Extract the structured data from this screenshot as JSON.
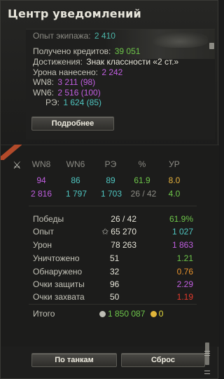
{
  "window": {
    "title": "Центр уведомлений"
  },
  "notification": {
    "crew_xp": {
      "label": "Опыт экипажа:",
      "value": "2 410"
    },
    "credits": {
      "label": "Получено кредитов:",
      "value": "39 051"
    },
    "achievements": {
      "label": "Достижения:",
      "value": "Знак классности «2 ст.»"
    },
    "damage": {
      "label": "Урона нанесено:",
      "value": "2 242"
    },
    "wn8": {
      "label": "WN8:",
      "value": "3 211 (98)"
    },
    "wn6": {
      "label": "WN6:",
      "value": "2 516 (100)"
    },
    "eff": {
      "label": "РЭ:",
      "value": "1 624 (85)"
    },
    "details_button": "Подробнее"
  },
  "stats_table": {
    "headers": [
      "WN8",
      "WN6",
      "РЭ",
      "%",
      "УР"
    ],
    "row1": [
      "94",
      "86",
      "89",
      "61.9",
      "8.0"
    ],
    "row2": [
      "2 816",
      "1 797",
      "1 703",
      "26 / 42",
      "4.0"
    ]
  },
  "details": [
    {
      "label": "Победы",
      "value": "26 / 42",
      "delta": "61.9%"
    },
    {
      "label": "Опыт",
      "value": "65 270",
      "delta": "1 027"
    },
    {
      "label": "Урон",
      "value": "78 263",
      "delta": "1 863"
    },
    {
      "label": "Уничтожено",
      "value": "51",
      "delta": "1.21"
    },
    {
      "label": "Обнаружено",
      "value": "32",
      "delta": "0.76"
    },
    {
      "label": "Очки защиты",
      "value": "96",
      "delta": "2.29"
    },
    {
      "label": "Очки захвата",
      "value": "50",
      "delta": "1.19"
    }
  ],
  "total": {
    "label": "Итого",
    "credits": "1 850 087",
    "gold": "0"
  },
  "buttons": {
    "by_tanks": "По танкам",
    "reset": "Сброс"
  },
  "colors": {
    "green": "#6ec64a",
    "purple": "#c05ee0",
    "cyan": "#4fc5c0",
    "orange": "#e8922c",
    "red": "#e43a2c",
    "yellow": "#e7dc3c"
  }
}
